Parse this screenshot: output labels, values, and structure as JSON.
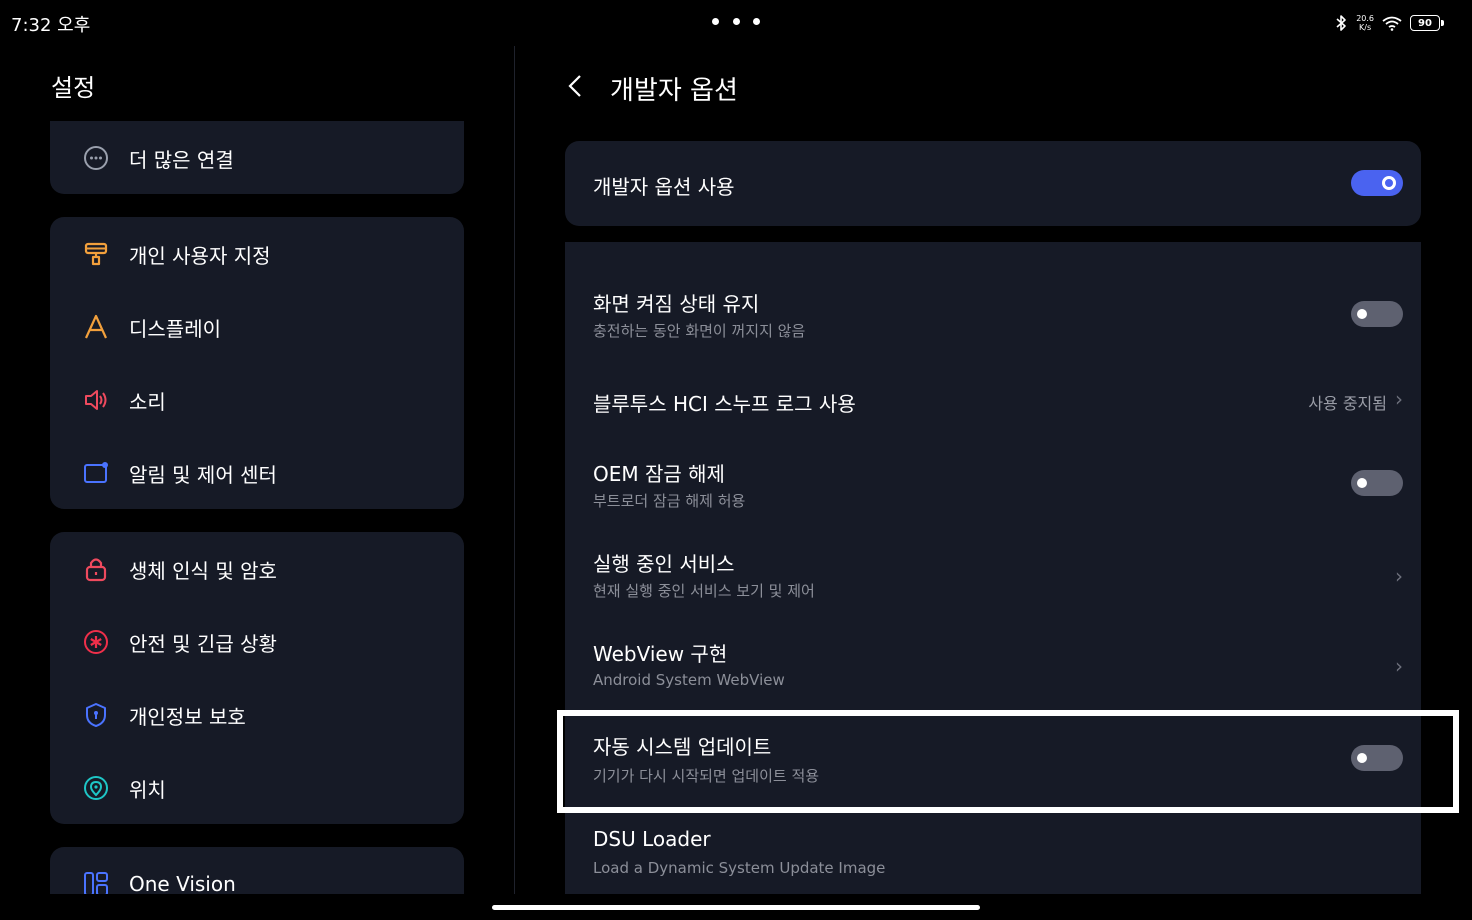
{
  "status": {
    "time": "7:32 오후",
    "net_speed_value": "20.6",
    "net_speed_unit": "K/s",
    "battery": "90"
  },
  "left": {
    "title": "설정",
    "items": [
      {
        "label": "더 많은 연결",
        "icon": "more-connections-icon",
        "color": "#9aa0ad"
      },
      {
        "label": "개인 사용자 지정",
        "icon": "paint-roller-icon",
        "color": "#f2a03c"
      },
      {
        "label": "디스플레이",
        "icon": "display-a-icon",
        "color": "#f2a03c"
      },
      {
        "label": "소리",
        "icon": "speaker-icon",
        "color": "#ef4a5e"
      },
      {
        "label": "알림 및 제어 센터",
        "icon": "notification-icon",
        "color": "#4a73ff"
      },
      {
        "label": "생체 인식 및 암호",
        "icon": "lock-icon",
        "color": "#ef4a5e"
      },
      {
        "label": "안전 및 긴급 상황",
        "icon": "emergency-icon",
        "color": "#ef2f4a"
      },
      {
        "label": "개인정보 보호",
        "icon": "shield-icon",
        "color": "#4a73ff"
      },
      {
        "label": "위치",
        "icon": "location-icon",
        "color": "#1ec6c6"
      },
      {
        "label": "One Vision",
        "icon": "one-vision-icon",
        "color": "#4a73ff"
      }
    ]
  },
  "right": {
    "title": "개발자 옵션",
    "master": {
      "title": "개발자 옵션 사용",
      "enabled": true
    },
    "settings": [
      {
        "title": "화면 켜짐 상태 유지",
        "subtitle": "충전하는 동안 화면이 꺼지지 않음",
        "type": "toggle",
        "enabled": false
      },
      {
        "title": "블루투스 HCI 스누프 로그 사용",
        "value": "사용 중지됨",
        "type": "link"
      },
      {
        "title": "OEM 잠금 해제",
        "subtitle": "부트로더 잠금 해제 허용",
        "type": "toggle",
        "enabled": false
      },
      {
        "title": "실행 중인 서비스",
        "subtitle": "현재 실행 중인 서비스 보기 및 제어",
        "type": "link"
      },
      {
        "title": "WebView 구현",
        "subtitle": "Android System WebView",
        "type": "link"
      },
      {
        "title": "자동 시스템 업데이트",
        "subtitle": "기기가 다시 시작되면 업데이트 적용",
        "type": "toggle",
        "enabled": false
      },
      {
        "title": "DSU Loader",
        "subtitle": "Load a Dynamic System Update Image",
        "type": "link"
      }
    ]
  },
  "colors": {
    "accent": "#4a63f0",
    "card": "#161a26",
    "highlight": "#ffffff"
  }
}
